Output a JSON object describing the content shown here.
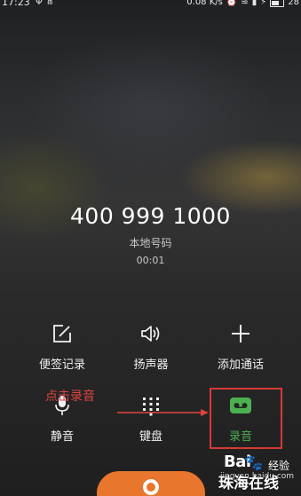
{
  "status_bar": {
    "time": "17:23",
    "network_speed": "0.08 K/s",
    "battery": "28"
  },
  "call": {
    "number": "400 999 1000",
    "location": "本地号码",
    "duration": "00:01"
  },
  "controls": {
    "memo": "便签记录",
    "speaker": "扬声器",
    "add_call": "添加通话",
    "mute": "静音",
    "keypad": "键盘",
    "record": "录音"
  },
  "annotation": {
    "text": "点击录音"
  },
  "watermark": {
    "brand": "Bai",
    "brand_suffix": "经验",
    "url": "jingyan.baidu.com",
    "site": "珠海在线"
  },
  "colors": {
    "record_accent": "#4caf50",
    "annotation_red": "#e0443c",
    "end_call": "#e8762c"
  }
}
